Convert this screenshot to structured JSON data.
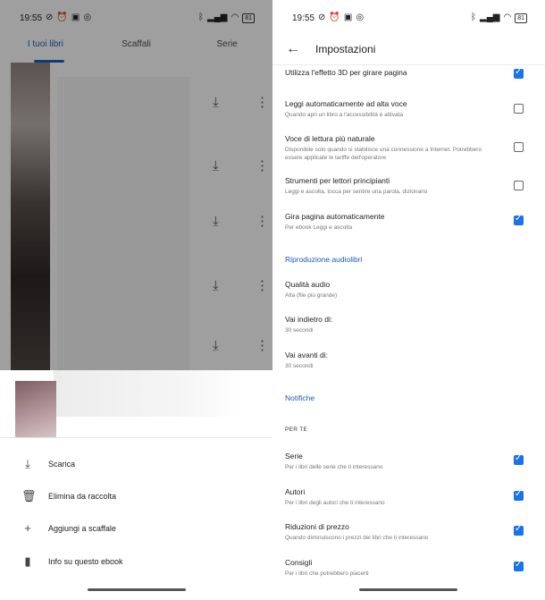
{
  "status_bar": {
    "time": "19:55",
    "battery": "81",
    "left_icons": [
      "no-alarm-icon",
      "alarm-icon",
      "nfc-icon",
      "whatsapp-icon"
    ],
    "right_icons": [
      "bluetooth-icon",
      "signal-icon",
      "wifi-icon",
      "battery-icon"
    ]
  },
  "library": {
    "tabs": [
      {
        "label": "I tuoi libri",
        "active": true
      },
      {
        "label": "Scaffali",
        "active": false
      },
      {
        "label": "Serie",
        "active": false
      }
    ],
    "book_rows": 5,
    "action_sheet": {
      "items": [
        {
          "label": "Scarica",
          "icon": "download-icon"
        },
        {
          "label": "Elimina da raccolta",
          "icon": "trash-icon"
        },
        {
          "label": "Aggiungi a scaffale",
          "icon": "plus-icon"
        },
        {
          "label": "Info su questo ebook",
          "icon": "book-icon"
        }
      ]
    }
  },
  "settings": {
    "title": "Impostazioni",
    "reading": [
      {
        "title": "Utilizza l'effetto 3D per girare pagina",
        "subtitle": "",
        "checked": true
      },
      {
        "title": "Leggi automaticamente ad alta voce",
        "subtitle": "Quando apri un libro a l'accessibilità è attivata",
        "checked": false
      },
      {
        "title": "Voce di lettura più naturale",
        "subtitle": "Disponibile solo quando si stabilisce una connessione a Internet. Potrebbero essere applicate le tariffe dell'operatore",
        "checked": false
      },
      {
        "title": "Strumenti per lettori principianti",
        "subtitle": "Leggi e ascolta, tocca per sentire una parola, dizionario",
        "checked": false
      },
      {
        "title": "Gira pagina automaticamente",
        "subtitle": "Per ebook Leggi e ascolta",
        "checked": true
      }
    ],
    "audiobook_section": "Riproduzione audiolibri",
    "audiobook": [
      {
        "title": "Qualità audio",
        "subtitle": "Alta (file più grande)"
      },
      {
        "title": "Vai indietro di:",
        "subtitle": "30 secondi"
      },
      {
        "title": "Vai avanti di:",
        "subtitle": "30 secondi"
      }
    ],
    "notifications_section": "Notifiche",
    "for_you_caption": "PER TE",
    "notifications": [
      {
        "title": "Serie",
        "subtitle": "Per i libri delle serie che ti interessano",
        "checked": true
      },
      {
        "title": "Autori",
        "subtitle": "Per i libri degli autori che ti interessano",
        "checked": true
      },
      {
        "title": "Riduzioni di prezzo",
        "subtitle": "Quando diminuiscono i prezzi dei libri che ti interessano",
        "checked": true
      },
      {
        "title": "Consigli",
        "subtitle": "Per i libri che potrebbero piacerti",
        "checked": true
      }
    ],
    "colors": {
      "accent": "#1a73e8",
      "section": "#1a5bb8"
    }
  }
}
